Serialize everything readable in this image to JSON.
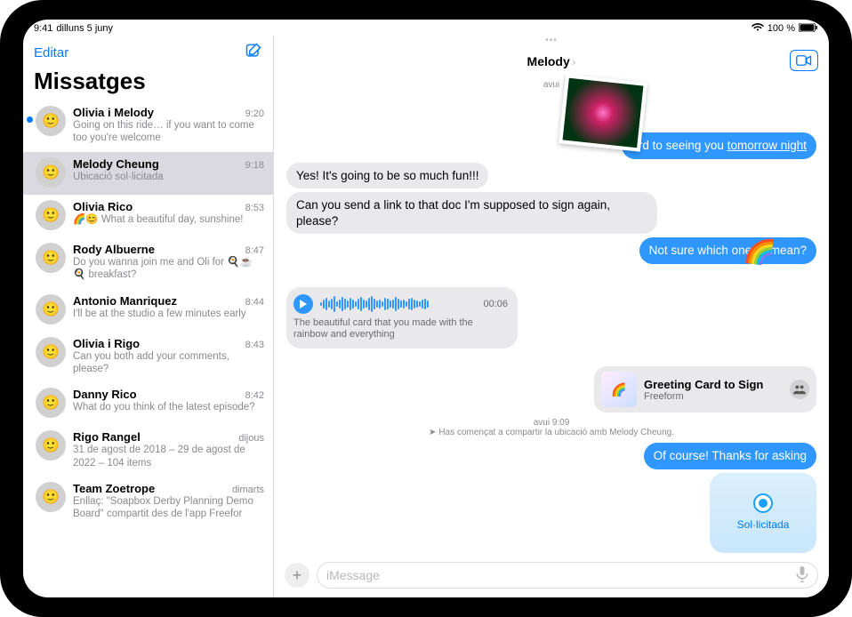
{
  "status": {
    "time": "9:41",
    "date": "dilluns 5 juny",
    "battery": "100 %",
    "wifi_icon": "wifi-icon"
  },
  "sidebar": {
    "edit_label": "Editar",
    "compose_icon": "compose-icon",
    "title": "Missatges",
    "conversations": [
      {
        "name": "Olivia i Melody",
        "time": "9:20",
        "preview": "Going on this ride… if you want to come too you're welcome",
        "unread": true
      },
      {
        "name": "Melody Cheung",
        "time": "9:18",
        "preview": "Ubicació sol·licitada",
        "selected": true
      },
      {
        "name": "Olivia Rico",
        "time": "8:53",
        "preview": "🌈😊 What a beautiful day, sunshine!"
      },
      {
        "name": "Rody Albuerne",
        "time": "8:47",
        "preview": "Do you wanna join me and Oli for 🍳☕🍳 breakfast?"
      },
      {
        "name": "Antonio Manriquez",
        "time": "8:44",
        "preview": "I'll be at the studio a few minutes early"
      },
      {
        "name": "Olivia i Rigo",
        "time": "8:43",
        "preview": "Can you both add your comments, please?"
      },
      {
        "name": "Danny Rico",
        "time": "8:42",
        "preview": "What do you think of the latest episode?"
      },
      {
        "name": "Rigo Rangel",
        "time": "dijous",
        "preview": "31 de agost de 2018 – 29 de agost de 2022 – 104 items"
      },
      {
        "name": "Team Zoetrope",
        "time": "dimarts",
        "preview": "Enllaç: \"Soapbox Derby Planning Demo Board\" compartit des de l'app Freefor"
      }
    ]
  },
  "chat": {
    "header_name": "Melody",
    "day_label": "avui",
    "messages": {
      "m_sent_top": "ard to seeing you tomorrow night",
      "m_sent_top_link": "tomorrow night",
      "m_recv_1": "Yes! It's going to be so much fun!!!",
      "m_recv_2": "Can you send a link to that doc I'm supposed to sign again, please?",
      "m_sent_2": "Not sure which one🌈 mean?",
      "audio_duration": "00:06",
      "audio_transcript": "The beautiful card that you made with the rainbow and everything",
      "attachment_title": "Greeting Card to Sign",
      "attachment_sub": "Freeform",
      "sys_time": "avui 9:09",
      "sys_text": "Has començat a compartir la ubicació amb Melody Cheung.",
      "m_sent_3": "Of course! Thanks for asking",
      "loc_label": "Sol·licitada"
    },
    "composer": {
      "placeholder": "iMessage"
    }
  }
}
